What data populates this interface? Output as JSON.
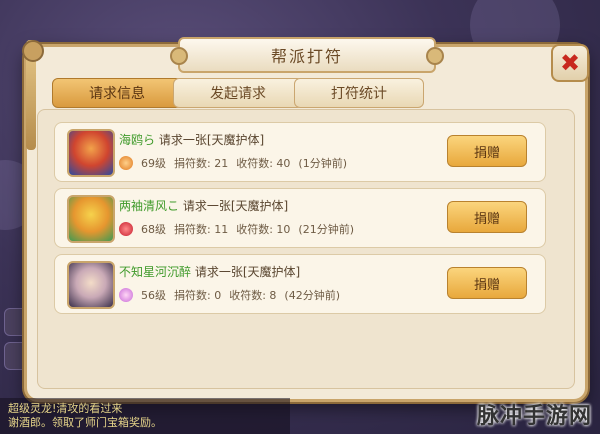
{
  "dialog": {
    "title": "帮派打符",
    "close_icon": "close-icon"
  },
  "tabs": [
    {
      "label": "请求信息",
      "active": true
    },
    {
      "label": "发起请求",
      "active": false
    },
    {
      "label": "打符统计",
      "active": false
    }
  ],
  "requests": [
    {
      "name": "海鸥ら",
      "request": "请求一张[天魔护体]",
      "level": "69级",
      "donated": "捐符数: 21",
      "received": "收符数: 40",
      "time": "(1分钟前)",
      "donate_label": "捐赠"
    },
    {
      "name": "两袖清风こ",
      "request": "请求一张[天魔护体]",
      "level": "68级",
      "donated": "捐符数: 11",
      "received": "收符数: 10",
      "time": "(21分钟前)",
      "donate_label": "捐赠"
    },
    {
      "name": "不知星河沉醉",
      "request": "请求一张[天魔护体]",
      "level": "56级",
      "donated": "捐符数: 0",
      "received": "收符数: 8",
      "time": "(42分钟前)",
      "donate_label": "捐赠"
    }
  ],
  "chat": {
    "line1": "超级灵龙!清攻的看过来",
    "line2": "谢酒郎。领取了师门宝箱奖励。"
  },
  "watermark": "脉冲手游网",
  "colors": {
    "accent": "#e8a83c",
    "name_green": "#3f9a2a",
    "close_red": "#c8281e"
  }
}
